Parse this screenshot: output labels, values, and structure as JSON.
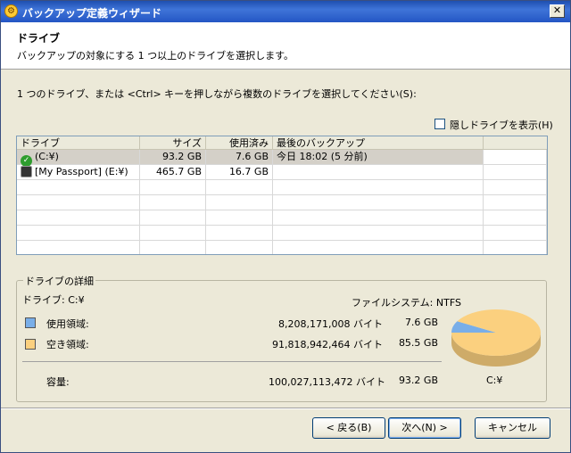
{
  "window": {
    "title": "バックアップ定義ウィザード",
    "close_glyph": "✕"
  },
  "header": {
    "title": "ドライブ",
    "subtitle": "バックアップの対象にする 1 つ以上のドライブを選択します。"
  },
  "instruction": "1 つのドライブ、または <Ctrl> キーを押しながら複数のドライブを選択してください(S):",
  "show_hidden": {
    "label": "隠しドライブを表示(H)",
    "checked": false
  },
  "drive_table": {
    "columns": [
      "ドライブ",
      "サイズ",
      "使用済み",
      "最後のバックアップ"
    ],
    "rows": [
      {
        "drive": "(C:¥)",
        "size": "93.2 GB",
        "used": "7.6 GB",
        "last_backup": "今日 18:02 (5 分前)",
        "icon": "check-icon",
        "selected": true
      },
      {
        "drive": "[My Passport] (E:¥)",
        "size": "465.7 GB",
        "used": "16.7 GB",
        "last_backup": "",
        "icon": "hard-drive-icon",
        "selected": false
      }
    ]
  },
  "details": {
    "legend": "ドライブの詳細",
    "drive_label": "ドライブ: C:¥",
    "filesystem_label": "ファイルシステム: NTFS",
    "used": {
      "label": "使用領域:",
      "bytes": "8,208,171,008 バイト",
      "size": "7.6 GB",
      "color": "#79aee8"
    },
    "free": {
      "label": "空き領域:",
      "bytes": "91,818,942,464 バイト",
      "size": "85.5 GB",
      "color": "#fbd07f"
    },
    "capacity": {
      "label": "容量:",
      "bytes": "100,027,113,472 バイト",
      "size": "93.2 GB"
    },
    "pie_caption": "C:¥"
  },
  "chart_data": {
    "type": "pie",
    "categories": [
      "使用領域",
      "空き領域"
    ],
    "values": [
      7.6,
      85.5
    ],
    "colors": [
      "#79aee8",
      "#fbd07f"
    ]
  },
  "buttons": {
    "back": "< 戻る(B)",
    "next": "次へ(N) >",
    "cancel": "キャンセル"
  }
}
